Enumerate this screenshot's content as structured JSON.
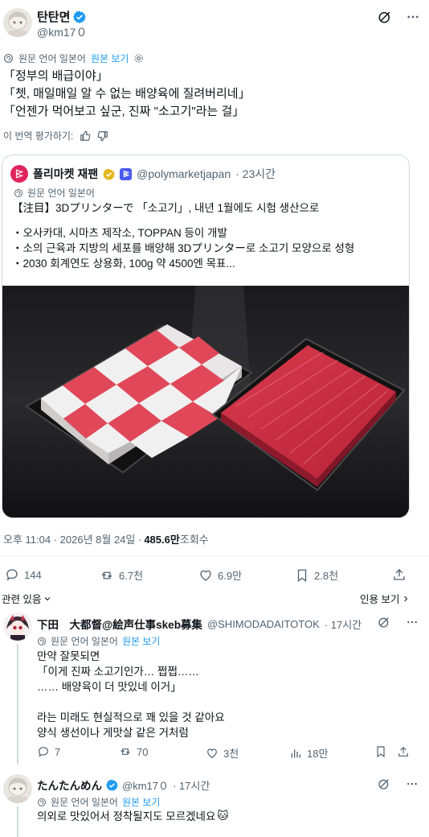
{
  "main_post": {
    "author_name": "탄탄면",
    "handle": "@km17０",
    "translation_note": "원문 언어 일본어",
    "view_original": "원본 보기",
    "text_lines": [
      "「정부의 배급이야」",
      "「쳇, 매일매일 알 수 없는 배양육에 질려버리네」",
      "「언젠가 먹어보고 싶군, 진짜 \"소고기\"라는 걸」"
    ],
    "rate_translation": "이 번역 평가하기:"
  },
  "quoted_post": {
    "author_name": "폴리마켓 재팬",
    "handle": "@polymarketjapan",
    "time": "· 23시간",
    "translation_note": "원문 언어 일본어",
    "text_lines": [
      "【注目】3Dプリンターで 「소고기」, 내년 1월에도 시험 생산으로",
      "",
      "・오사카대, 시마츠 제작소, TOPPAN 등이 개발",
      "・소의 근육과 지방의 세포를 배양해 3Dプリンター로 소고기 모양으로 성형",
      "・2030 회계연도 상용화, 100g 약 4500엔 목표..."
    ]
  },
  "meta": {
    "timestamp": "오후 11:04 · 2026년 8월 24일 · ",
    "views_count": "485.6만",
    "views_label": " 조회수"
  },
  "actions": {
    "replies": "144",
    "reposts": "6.7천",
    "likes": "6.9만",
    "bookmarks": "2.8천"
  },
  "related": {
    "label": "관련 있음",
    "quotes_label": "인용 보기"
  },
  "reply1": {
    "author_name": "下田　大都督@絵声仕事skeb募集",
    "handle": "@SHIMODADAITOTOK",
    "time": "· 17시간",
    "translation_note": "원문 언어 일본어",
    "view_original": "원본 보기",
    "text_lines": [
      "만약 잘못되면",
      "「이게 진짜 소고기인가… 쩝쩝……",
      "…… 배양육이 더 맛있네 이거」",
      "",
      "라는 미래도 현실적으로 꽤 있을 것 같아요",
      "양식 생선이나 게맛살 같은 거처럼"
    ],
    "actions": {
      "replies": "7",
      "reposts": "70",
      "likes": "3천",
      "views": "18만"
    }
  },
  "reply2": {
    "author_name": "たんたんめん",
    "handle": "@km17０",
    "time": "· 17시간",
    "translation_note": "원문 언어 일본어",
    "view_original": "원본 보기",
    "text": "의외로 맛있어서 정착될지도 모르겠네요",
    "emoji": "🐱"
  },
  "colors": {
    "accent": "#1d9bf0",
    "muted": "#536471",
    "verified_gold": "#e2b719",
    "border": "#cfd9de"
  },
  "icons": [
    "verified-badge-icon",
    "grok-icon",
    "more-icon",
    "translate-icon",
    "settings-icon",
    "reply-icon",
    "repost-icon",
    "like-icon",
    "bookmark-icon",
    "share-icon",
    "chevron-down-icon",
    "chevron-right-icon",
    "views-icon",
    "cat-emoji"
  ]
}
